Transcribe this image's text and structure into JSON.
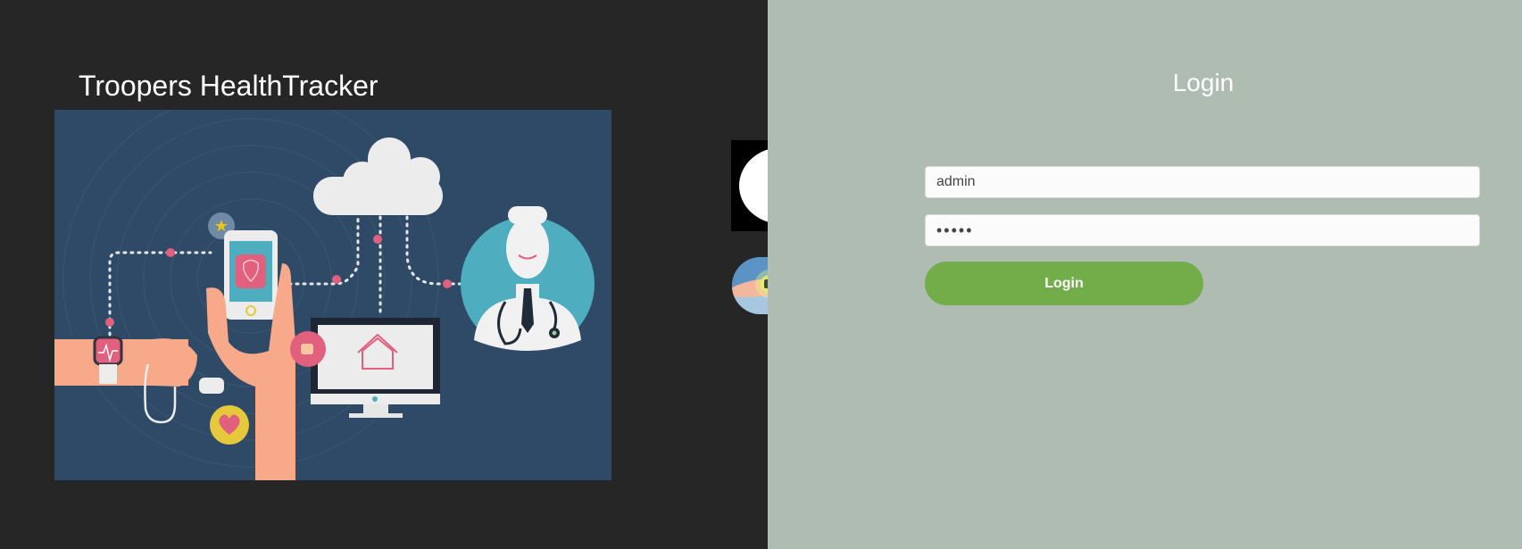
{
  "app": {
    "title": "Troopers HealthTracker"
  },
  "login": {
    "title": "Login",
    "username_value": "admin",
    "password_value": "admin",
    "button_label": "Login"
  },
  "icons": {
    "play": "play-icon",
    "health_thumbnail": "smartwatch-thumbnail"
  },
  "colors": {
    "left_background": "#262626",
    "right_background": "#aebcb1",
    "login_button": "#72ad4a",
    "illustration_background": "#2f4a66"
  }
}
